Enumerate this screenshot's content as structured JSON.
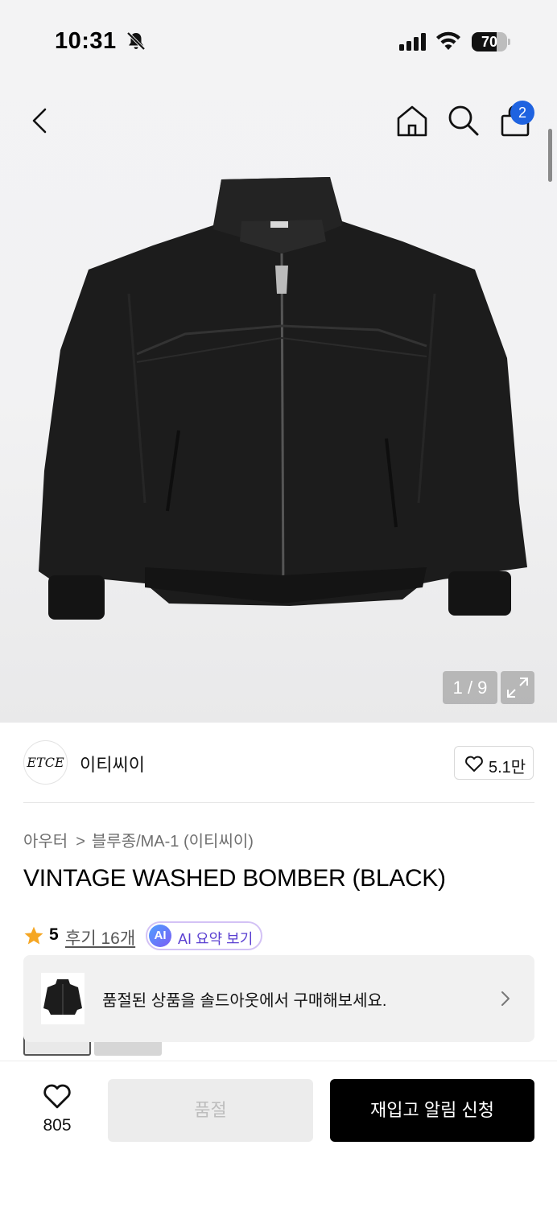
{
  "status_bar": {
    "time": "10:31",
    "battery_percent": "70",
    "icons": [
      "bell-slash-icon",
      "cellular-signal-icon",
      "wifi-icon",
      "battery-icon"
    ]
  },
  "nav": {
    "icons": [
      "chevron-left-icon",
      "home-icon",
      "search-icon",
      "shopping-bag-icon"
    ],
    "cart_count": "2"
  },
  "gallery": {
    "counter": "1 / 9",
    "product_image": "black-bomber-jacket-photo",
    "expand_icon": "expand-arrows-icon"
  },
  "brand": {
    "logo_text": "ETCE",
    "name": "이티씨이",
    "like_count": "5.1만"
  },
  "product": {
    "breadcrumb": [
      "아우터",
      "블루종/MA-1 (이티씨이)"
    ],
    "breadcrumb_separator": ">",
    "title": "VINTAGE WASHED BOMBER (BLACK)",
    "rating": "5",
    "review_link": "후기 16개",
    "ai_badge": "AI",
    "ai_summary_label": "AI 요약 보기"
  },
  "soldout_banner": {
    "text": "품절된 상품을 솔드아웃에서 구매해보세요."
  },
  "bottom_bar": {
    "wish_count": "805",
    "soldout_label": "품절",
    "restock_label": "재입고 알림 신청"
  },
  "colors": {
    "accent_blue": "#1f63e0",
    "star": "#f5a623",
    "ai_purple": "#5a3fd1",
    "cta_black": "#000000"
  }
}
